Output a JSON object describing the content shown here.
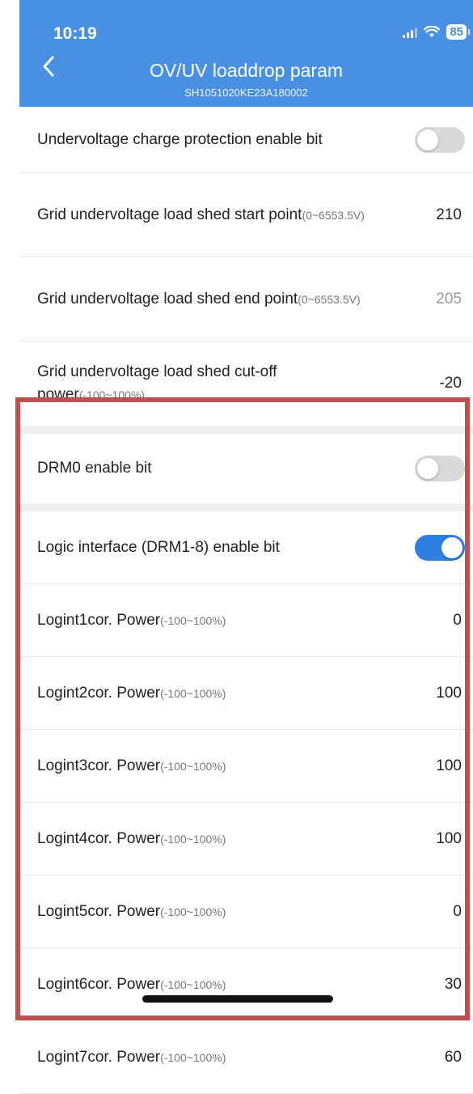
{
  "status_bar": {
    "time": "10:19",
    "battery": "85"
  },
  "header": {
    "title": "OV/UV loaddrop param",
    "subtitle": "SH1051020KE23A180002"
  },
  "rows_top": [
    {
      "label": "Undervoltage charge protection enable bit",
      "type": "toggle",
      "state": "off"
    },
    {
      "label": "Grid undervoltage load shed start point",
      "range": "(0~6553.5V)",
      "value": "210"
    },
    {
      "label": "Grid undervoltage load shed end point",
      "range": "(0~6553.5V)",
      "value": "205"
    },
    {
      "label": "Grid undervoltage load shed cut-off power",
      "range": "(-100~100%)",
      "value": "-20"
    }
  ],
  "drm0": {
    "label": "DRM0 enable bit",
    "state": "off"
  },
  "logic_interface": {
    "label": "Logic interface (DRM1-8) enable bit",
    "state": "on"
  },
  "logint_rows": [
    {
      "label": "Logint1cor. Power",
      "range": "(-100~100%)",
      "value": "0"
    },
    {
      "label": "Logint2cor. Power",
      "range": "(-100~100%)",
      "value": "100"
    },
    {
      "label": "Logint3cor. Power",
      "range": "(-100~100%)",
      "value": "100"
    },
    {
      "label": "Logint4cor. Power",
      "range": "(-100~100%)",
      "value": "100"
    },
    {
      "label": "Logint5cor. Power",
      "range": "(-100~100%)",
      "value": "0"
    },
    {
      "label": "Logint6cor. Power",
      "range": "(-100~100%)",
      "value": "30"
    },
    {
      "label": "Logint7cor. Power",
      "range": "(-100~100%)",
      "value": "60"
    }
  ],
  "colors": {
    "header": "#4a90e2",
    "toggle_on": "#2f7fe3",
    "highlight": "#c0504d"
  }
}
